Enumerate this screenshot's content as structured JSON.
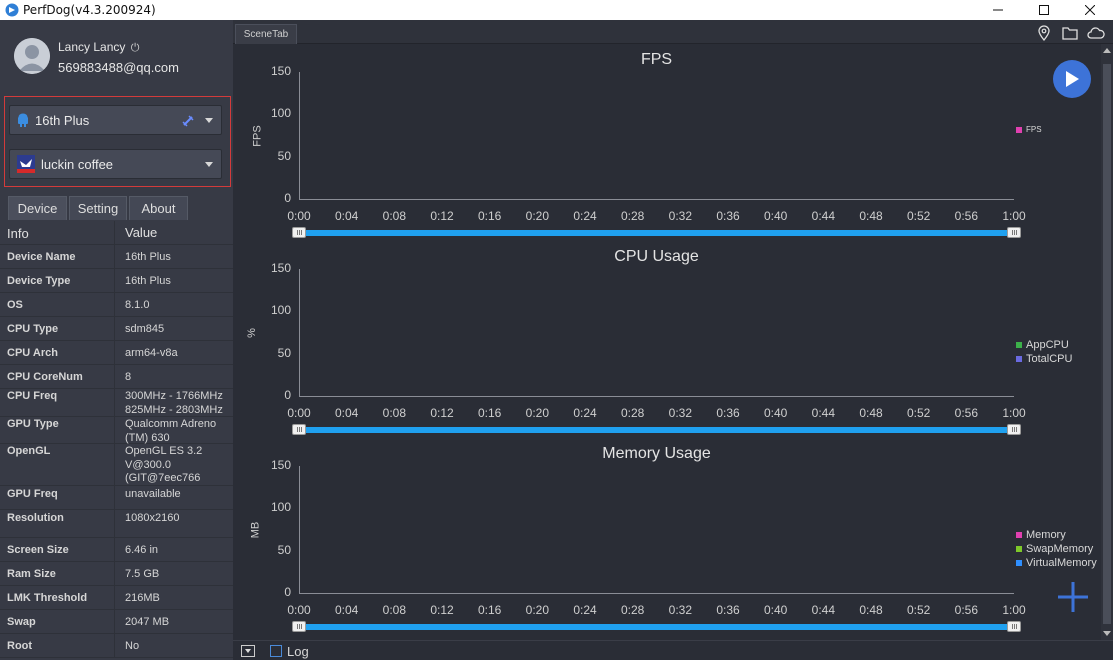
{
  "window": {
    "title": "PerfDog(v4.3.200924)"
  },
  "user": {
    "name": "Lancy Lancy",
    "email": "569883488@qq.com"
  },
  "device_select": {
    "value": "16th Plus"
  },
  "app_select": {
    "value": "luckin coffee"
  },
  "tabs": [
    {
      "label": "Device"
    },
    {
      "label": "Setting"
    },
    {
      "label": "About"
    }
  ],
  "info_table": {
    "headers": {
      "key": "Info",
      "value": "Value"
    },
    "rows": [
      {
        "key": "Device Name",
        "value": "16th Plus"
      },
      {
        "key": "Device Type",
        "value": "16th Plus"
      },
      {
        "key": "OS",
        "value": "8.1.0"
      },
      {
        "key": "CPU Type",
        "value": "sdm845"
      },
      {
        "key": "CPU Arch",
        "value": "arm64-v8a"
      },
      {
        "key": "CPU CoreNum",
        "value": "8"
      },
      {
        "key": "CPU Freq",
        "value": "300MHz - 1766MHz\n825MHz - 2803MHz"
      },
      {
        "key": "GPU Type",
        "value": "Qualcomm Adreno\n(TM) 630"
      },
      {
        "key": "OpenGL",
        "value": "OpenGL ES 3.2\nV@300.0\n(GIT@7eec766"
      },
      {
        "key": "GPU Freq",
        "value": "unavailable"
      },
      {
        "key": "Resolution",
        "value": "1080x2160"
      },
      {
        "key": "Screen Size",
        "value": "6.46 in"
      },
      {
        "key": "Ram Size",
        "value": "7.5 GB"
      },
      {
        "key": "LMK Threshold",
        "value": "216MB"
      },
      {
        "key": "Swap",
        "value": "2047 MB"
      },
      {
        "key": "Root",
        "value": "No"
      }
    ]
  },
  "scene_tab": {
    "label": "SceneTab"
  },
  "bottom": {
    "log_label": "Log",
    "log_checked": false
  },
  "icons": {
    "location": "location-pin-icon",
    "folder": "folder-icon",
    "cloud": "cloud-icon",
    "play": "play-icon",
    "add": "plus-icon"
  },
  "colors": {
    "accent": "#1fa0ef",
    "play_button": "#3d73d8",
    "selection_border": "#d33b3b",
    "fps": "#e040b0",
    "app_cpu": "#3cb04a",
    "total_cpu": "#6a6ae0",
    "memory": "#e040b0",
    "swap_memory": "#7ec82a",
    "virtual_memory": "#2f8fff"
  },
  "chart_data": [
    {
      "type": "line",
      "title": "FPS",
      "ylabel": "FPS",
      "ylim": [
        0,
        150
      ],
      "yticks": [
        "0",
        "50",
        "100",
        "150"
      ],
      "xticks": [
        "0:00",
        "0:04",
        "0:08",
        "0:12",
        "0:16",
        "0:20",
        "0:24",
        "0:28",
        "0:32",
        "0:36",
        "0:40",
        "0:44",
        "0:48",
        "0:52",
        "0:56",
        "1:00"
      ],
      "series": [
        {
          "name": "FPS",
          "color": "#e040b0",
          "values": []
        }
      ],
      "legend": "right",
      "legend_size": "small"
    },
    {
      "type": "line",
      "title": "CPU Usage",
      "ylabel": "%",
      "ylim": [
        0,
        150
      ],
      "yticks": [
        "0",
        "50",
        "100",
        "150"
      ],
      "xticks": [
        "0:00",
        "0:04",
        "0:08",
        "0:12",
        "0:16",
        "0:20",
        "0:24",
        "0:28",
        "0:32",
        "0:36",
        "0:40",
        "0:44",
        "0:48",
        "0:52",
        "0:56",
        "1:00"
      ],
      "series": [
        {
          "name": "AppCPU",
          "color": "#3cb04a",
          "values": []
        },
        {
          "name": "TotalCPU",
          "color": "#6a6ae0",
          "values": []
        }
      ],
      "legend": "right"
    },
    {
      "type": "line",
      "title": "Memory Usage",
      "ylabel": "MB",
      "ylim": [
        0,
        150
      ],
      "yticks": [
        "0",
        "50",
        "100",
        "150"
      ],
      "xticks": [
        "0:00",
        "0:04",
        "0:08",
        "0:12",
        "0:16",
        "0:20",
        "0:24",
        "0:28",
        "0:32",
        "0:36",
        "0:40",
        "0:44",
        "0:48",
        "0:52",
        "0:56",
        "1:00"
      ],
      "series": [
        {
          "name": "Memory",
          "color": "#e040b0",
          "values": []
        },
        {
          "name": "SwapMemory",
          "color": "#7ec82a",
          "values": []
        },
        {
          "name": "VirtualMemory",
          "color": "#2f8fff",
          "values": []
        }
      ],
      "legend": "right"
    }
  ]
}
